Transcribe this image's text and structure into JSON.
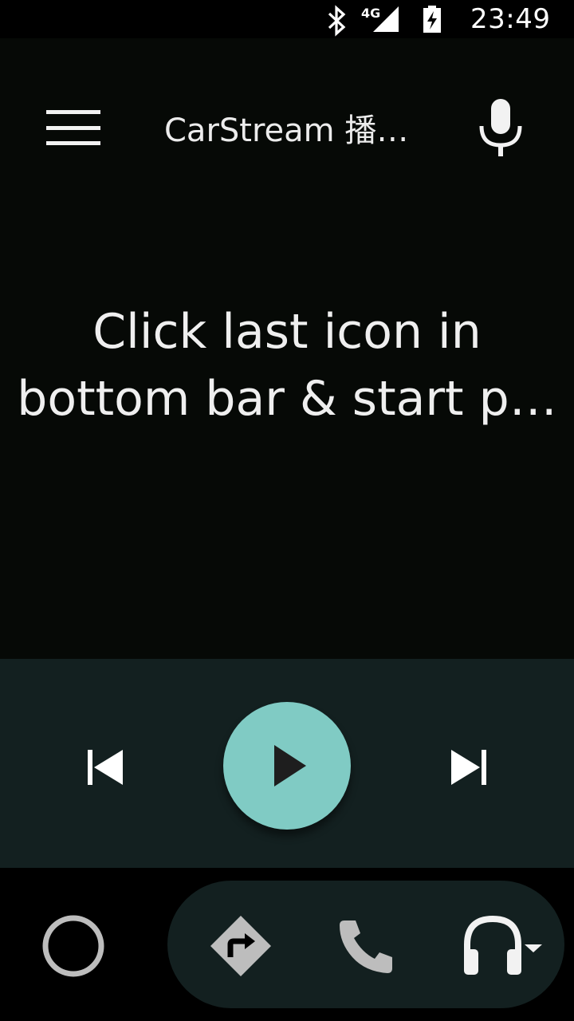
{
  "status_bar": {
    "time": "23:49",
    "network": "4G",
    "icons": [
      "bluetooth-icon",
      "signal-4g-icon",
      "battery-charging-icon"
    ]
  },
  "app_bar": {
    "title": "CarStream 播…",
    "icons": [
      "menu-icon",
      "mic-icon"
    ]
  },
  "main": {
    "message_lines": [
      "Click last icon in",
      "bottom bar & start p…"
    ]
  },
  "controls": {
    "icons": [
      "skip-previous-icon",
      "play-icon",
      "skip-next-icon"
    ],
    "accent": "#80cbc4",
    "background": "#132020"
  },
  "nav_bar": {
    "icons": [
      "home-circle-icon",
      "navigation-icon",
      "phone-icon",
      "headphones-icon",
      "dropdown-arrow-icon"
    ]
  },
  "colors": {
    "app_background": "#060906",
    "text": "#efefef"
  }
}
